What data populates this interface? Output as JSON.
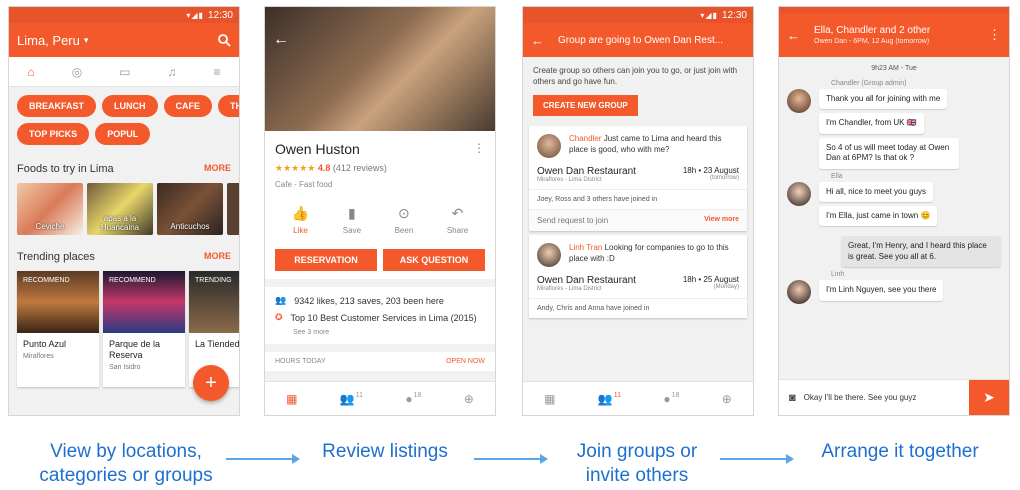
{
  "status_time": "12:30",
  "screen1": {
    "title": "Lima, Peru",
    "chips": [
      "BREAKFAST",
      "LUNCH",
      "CAFE",
      "THINGS TO DO",
      "TOP PICKS",
      "POPUL"
    ],
    "foods_heading": "Foods to try in Lima",
    "more_label": "MORE",
    "foods": [
      "Ceviche",
      "apas a la Huancaina",
      "Anticuchos"
    ],
    "trending_heading": "Trending places",
    "places": [
      {
        "tag": "RECOMMEND",
        "name": "Punto Azul",
        "loc": "Miraflores"
      },
      {
        "tag": "RECOMMEND",
        "name": "Parque de la Reserva",
        "loc": "San Isidro"
      },
      {
        "tag": "TRENDING",
        "name": "La Tiended",
        "loc": ""
      }
    ],
    "fab": "+"
  },
  "screen2": {
    "name": "Owen Huston",
    "stars": "★★★★★",
    "rating": "4.8",
    "reviews": "(412 reviews)",
    "category": "Cafe - Fast food",
    "actions": [
      "Like",
      "Save",
      "Been",
      "Share"
    ],
    "reservation_label": "RESERVATION",
    "ask_label": "ASK QUESTION",
    "stats": "9342 likes, 213 saves, 203 been here",
    "award": "Top 10 Best Customer Services in Lima (2015)",
    "see_more": "See 3 more",
    "hours_label": "HOURS TODAY",
    "open_now": "OPEN NOW",
    "counts": [
      "11",
      "18"
    ]
  },
  "screen3": {
    "title": "Group are going to Owen Dan Rest...",
    "intro": "Create group so others can join you to go, or just join with others and go have fun.",
    "create_label": "CREATE NEW GROUP",
    "groups": [
      {
        "who": "Chandler",
        "msg": "Just came to Lima and heard this place is good, who with me?",
        "place": "Owen Dan Restaurant",
        "area": "Miraflores - Lima District",
        "time": "18h • 23 August",
        "when": "(tomorrow)",
        "joined": "Joey, Ross and 3 others have joined in"
      },
      {
        "who": "Linh Tran",
        "msg": "Looking for companies to go to this place with :D",
        "place": "Owen Dan Restaurant",
        "area": "Miraflores - Lima District",
        "time": "18h • 25 August",
        "when": "(Monday)",
        "joined": "Andy, Chris and Anna have joined in"
      }
    ],
    "send_request": "Send request to join",
    "view_more": "View more",
    "counts": [
      "11",
      "18"
    ]
  },
  "screen4": {
    "title": "Ella, Chandler and 2 other",
    "subtitle": "Owen Dan - 6PM, 12 Aug (tomorrow)",
    "time": "9h23 AM - Tue",
    "chandler_label": "Chandler (Group admin)",
    "chandler_msgs": [
      "Thank you all for joining with me",
      "I'm Chandler, from UK 🇬🇧",
      "So 4 of us will meet today at Owen Dan at 6PM? Is that ok ?"
    ],
    "ella_label": "Ella",
    "ella_msgs": [
      "Hi all, nice to meet you guys",
      "I'm Ella, just came in town 😊"
    ],
    "me_msg": "Great, I'm Henry, and I heard this place is great. See you all at 6.",
    "linh_label": "Linh",
    "linh_msg": "I'm Linh Nguyen, see you there",
    "input_text": "Okay I'll be there. See you guyz"
  },
  "captions": [
    "View by locations, categories or groups",
    "Review listings",
    "Join groups or invite others",
    "Arrange it together"
  ],
  "colors": {
    "accent": "#f4592b",
    "caption": "#1d6fd0"
  }
}
